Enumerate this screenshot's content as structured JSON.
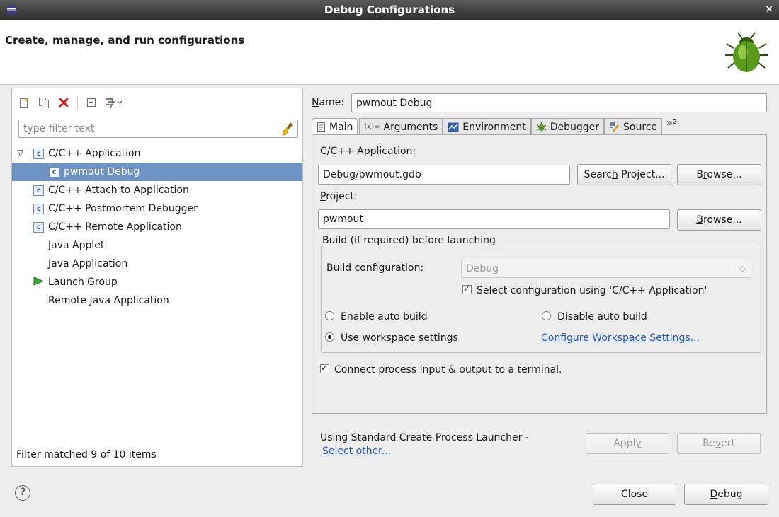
{
  "window": {
    "title": "Debug Configurations",
    "close_glyph": "×"
  },
  "header": {
    "heading": "Create, manage, and run configurations",
    "icon": "bug-icon"
  },
  "left": {
    "toolbar": [
      {
        "icon": "new-config-icon"
      },
      {
        "icon": "duplicate-icon"
      },
      {
        "icon": "delete-icon"
      },
      {
        "icon": "collapse-all-icon"
      },
      {
        "icon": "filter-icon"
      }
    ],
    "filter_placeholder": "type filter text",
    "tree": [
      {
        "label": "C/C++ Application",
        "icon": "c-icon",
        "expanded": true
      },
      {
        "label": "pwmout Debug",
        "icon": "c-icon",
        "child": true,
        "selected": true
      },
      {
        "label": "C/C++ Attach to Application",
        "icon": "c-icon"
      },
      {
        "label": "C/C++ Postmortem Debugger",
        "icon": "c-icon"
      },
      {
        "label": "C/C++ Remote Application",
        "icon": "c-icon"
      },
      {
        "label": "Java Applet"
      },
      {
        "label": "Java Application"
      },
      {
        "label": "Launch Group",
        "icon": "launch-icon"
      },
      {
        "label": "Remote Java Application"
      }
    ],
    "status": "Filter matched 9 of 10 items"
  },
  "right": {
    "name_label_mnemonic": "N",
    "name_label_rest": "ame:",
    "name_value": "pwmout Debug",
    "tabs": [
      {
        "label": "Main",
        "icon": "main-tab-icon"
      },
      {
        "label": "Arguments",
        "icon": "arguments-icon"
      },
      {
        "label": "Environment",
        "icon": "environment-icon"
      },
      {
        "label": "Debugger",
        "icon": "debugger-icon"
      },
      {
        "label": "Source",
        "icon": "source-icon"
      }
    ],
    "more_tabs": "»",
    "more_count": "2",
    "main": {
      "app_label": "C/C++ Application:",
      "app_value": "Debug/pwmout.gdb",
      "search_btn_pre": "Searc",
      "search_btn_mn": "h",
      "search_btn_post": " Project...",
      "browse1_pre": "B",
      "browse1_mn": "r",
      "browse1_post": "owse...",
      "project_label_mn": "P",
      "project_label_rest": "roject:",
      "project_value": "pwmout",
      "browse2_mn": "B",
      "browse2_post": "rowse...",
      "build_group_label": "Build (if required) before launching",
      "build_config_label": "Build configuration:",
      "build_config_value": "Debug",
      "select_config_label": "Select configuration using 'C/C++ Application'",
      "enable_auto_build": "Enable auto build",
      "disable_auto_build": "Disable auto build",
      "use_workspace": "Use workspace settings",
      "configure_link": "Configure Workspace Settings...",
      "connect_terminal": "Connect process input & output to a terminal."
    },
    "launcher_text": "Using Standard Create Process Launcher -",
    "select_other": "Select other...",
    "apply_pre": "Appl",
    "apply_mn": "y",
    "revert_pre": "Re",
    "revert_mn": "v",
    "revert_post": "ert"
  },
  "footer": {
    "help_glyph": "?",
    "close_label": "Close",
    "debug_mn": "D",
    "debug_rest": "ebug"
  }
}
